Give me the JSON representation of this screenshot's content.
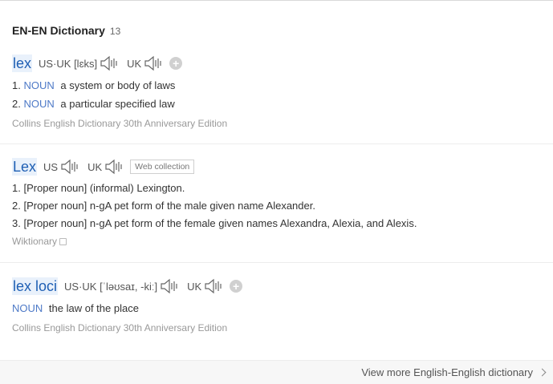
{
  "header": {
    "title": "EN-EN Dictionary",
    "count": "13"
  },
  "entries": [
    {
      "word": "lex",
      "phon_label": "US·UK [lɛks]",
      "uk_label": "UK",
      "defs": [
        {
          "num": "1.",
          "pos": "NOUN",
          "text": "a system or body of laws"
        },
        {
          "num": "2.",
          "pos": "NOUN",
          "text": "a particular specified law"
        }
      ],
      "source": "Collins English Dictionary 30th Anniversary Edition"
    },
    {
      "word": "Lex",
      "us_label": "US",
      "uk_label": "UK",
      "tag": "Web collection",
      "defs": [
        {
          "num": "1.",
          "text": "[Proper noun] (informal) Lexington."
        },
        {
          "num": "2.",
          "text": "[Proper noun] n-gA pet form of the male given name Alexander."
        },
        {
          "num": "3.",
          "text": "[Proper noun] n-gA pet form of the female given names Alexandra, Alexia, and Alexis."
        }
      ],
      "source": "Wiktionary"
    },
    {
      "word": "lex loci",
      "phon_label": "US·UK [ˈləʊsaɪ, -kiː]",
      "uk_label": "UK",
      "defs": [
        {
          "pos": "NOUN",
          "text": "the law of the place"
        }
      ],
      "source": "Collins English Dictionary 30th Anniversary Edition"
    }
  ],
  "footer": {
    "link": "View more English-English dictionary"
  },
  "icons": {
    "speaker": "speaker-icon",
    "add": "plus-icon",
    "external": "external-link-icon",
    "chevron": "chevron-right-icon"
  }
}
